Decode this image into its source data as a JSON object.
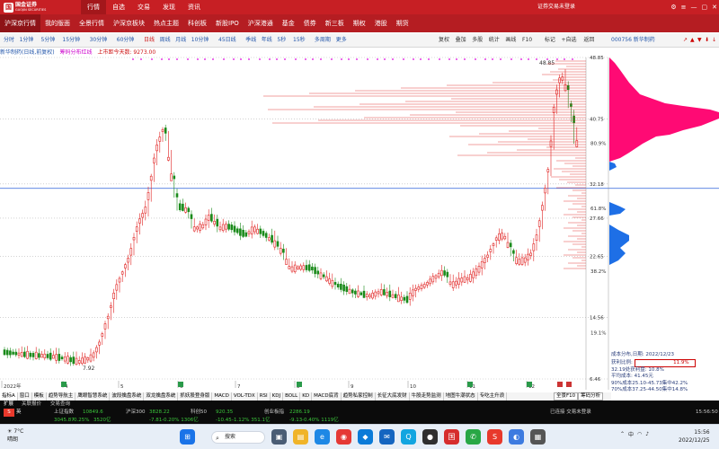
{
  "titlebar": {
    "brand_mark": "国",
    "brand": "国金证券",
    "brand_sub": "GUOJIN SECURITIES",
    "menu": [
      "行情",
      "自选",
      "交易",
      "发现",
      "资讯"
    ],
    "login": "证券交易未登录",
    "controls": [
      "⚙",
      "≡",
      "—",
      "▢",
      "✕"
    ]
  },
  "subnav": [
    "沪深京行情",
    "我的版面",
    "全景行情",
    "沪深京板块",
    "热点主题",
    "科创板",
    "新股IPO",
    "沪深港通",
    "基金",
    "债券",
    "新三板",
    "期权",
    "港股",
    "期货"
  ],
  "toolbar": {
    "periods": [
      "分时",
      "1分钟",
      "5分钟",
      "15分钟",
      "30分钟",
      "60分钟",
      "日线",
      "周线",
      "月线",
      "10分钟",
      "45日线",
      "季线",
      "年线",
      "5秒",
      "15秒",
      "多周期",
      "更多"
    ],
    "actions": [
      "复权",
      "叠加",
      "多股",
      "统计",
      "画线",
      "F10",
      "标记",
      "+自选",
      "返回"
    ],
    "code": "000756 新华制药",
    "icons": [
      "↗",
      "▲",
      "▼",
      "⬇",
      "↓"
    ]
  },
  "info": {
    "title": "新华制药(日线,前复权)",
    "indicator": "筹码分布红线",
    "listed": "上市距今天数: 9273.00"
  },
  "price_axis": [
    "48.85",
    "40.75",
    "32.18",
    "27.66",
    "22.65",
    "14.56",
    "6.46"
  ],
  "pct_axis": [
    "80.9%",
    "61.8%",
    "38.2%",
    "19.1%"
  ],
  "chart_labels": {
    "high": "40.75",
    "low": "7.92",
    "top": "48.85"
  },
  "months": [
    "2022年",
    "4",
    "5",
    "6",
    "7",
    "8",
    "9",
    "10",
    "11",
    "12"
  ],
  "chart_data": {
    "type": "candlestick",
    "title": "新华制药(日线,前复权)",
    "ylim": [
      6.46,
      48.85
    ],
    "y_ticks": [
      48.85,
      40.75,
      32.18,
      27.66,
      22.65,
      14.56,
      6.46
    ],
    "key_points": {
      "low": 7.92,
      "high_1": 40.75,
      "high_2": 48.85
    },
    "x_labels": [
      "2022年",
      "4",
      "5",
      "6",
      "7",
      "8",
      "9",
      "10",
      "11",
      "12"
    ]
  },
  "chip_dist": {
    "date_label": "成本分布,日期:",
    "date": "2022/12/23",
    "profit_label": "获利比例:",
    "profit": "11.9%",
    "profit_line": "32.19处获利盘: 10.8%",
    "avg": "平均成本: 41.45元",
    "c90": "90%成本25.10-45.73集中42.2%",
    "c70": "70%成本37.25-44.50集中14.8%"
  },
  "indicators": [
    "指标A",
    "窗口",
    "模板",
    "趋势导航主",
    "鹰眼智慧系统",
    "波段擒盘系统",
    "双龙擒盘系统",
    "抓妖股登身版",
    "MACD",
    "VOL-TDX",
    "RSI",
    "KDJ",
    "BOLL",
    "KD",
    "MACD底背",
    "趋势私家控制",
    "长征大底发财",
    "牛股走势监测",
    "地图牛潮状态",
    "专吃主升浪"
  ],
  "right_tabs": [
    "全景F10",
    "筹码分析"
  ],
  "status": {
    "row1": [
      "扩展",
      "关联报价",
      "交易查询"
    ],
    "idx": [
      {
        "name": "上证指数",
        "val": "3045.87",
        "chg": "-0.25%",
        "amt": "3520亿"
      },
      {
        "name": "深证成指",
        "val": "10849.6",
        "chg": "",
        "amt": ""
      },
      {
        "name": "沪深300",
        "val": "3828.22",
        "chg": "-7.81",
        "amt": "-0.20% 1306亿"
      },
      {
        "name": "科创50",
        "val": "920.35",
        "chg": "-10.45",
        "amt": "-1.12% 351.1亿"
      },
      {
        "name": "创业板指",
        "val": "2286.19",
        "chg": "-9.13",
        "amt": "-0.40% 1119亿"
      }
    ],
    "trade": "已连接 交易未登录",
    "time": "15:56:50"
  },
  "taskbar": {
    "weather_temp": "7°C",
    "weather_desc": "晴朗",
    "search": "搜索",
    "time": "15:56",
    "date": "2022/12/25",
    "lang": "中"
  }
}
